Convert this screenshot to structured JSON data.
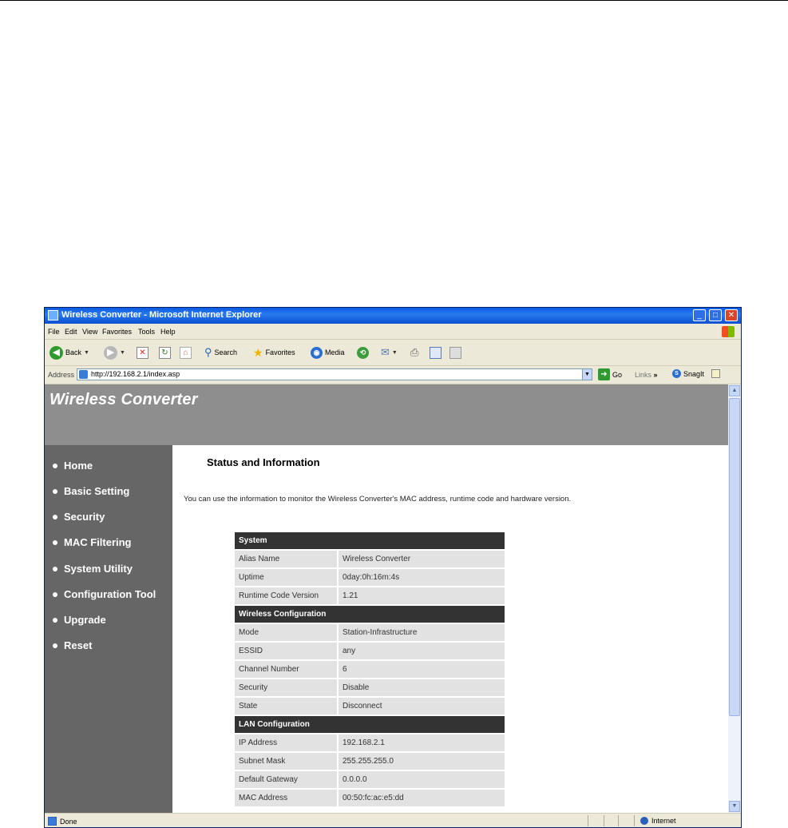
{
  "window": {
    "title": "Wireless Converter - Microsoft Internet Explorer",
    "controls": {
      "minimize": "_",
      "maximize": "□",
      "close": "✕"
    }
  },
  "menu": [
    "File",
    "Edit",
    "View",
    "Favorites",
    "Tools",
    "Help"
  ],
  "toolbar": {
    "back": "Back",
    "search": "Search",
    "favorites": "Favorites",
    "media": "Media"
  },
  "address": {
    "label": "Address",
    "url": "http://192.168.2.1/index.asp",
    "go": "Go",
    "links": "Links",
    "snagit": "SnagIt"
  },
  "page": {
    "banner_title": "Wireless Converter",
    "nav": [
      "Home",
      "Basic Setting",
      "Security",
      "MAC Filtering",
      "System Utility",
      "Configuration Tool",
      "Upgrade",
      "Reset"
    ],
    "title": "Status and Information",
    "intro": "You can use the information to monitor the Wireless Converter's MAC address, runtime code and hardware version.",
    "sections": [
      {
        "header": "System",
        "rows": [
          {
            "key": "Alias Name",
            "value": "Wireless Converter"
          },
          {
            "key": "Uptime",
            "value": "0day:0h:16m:4s"
          },
          {
            "key": "Runtime Code Version",
            "value": "1.21"
          }
        ]
      },
      {
        "header": "Wireless Configuration",
        "rows": [
          {
            "key": "Mode",
            "value": "Station-Infrastructure"
          },
          {
            "key": "ESSID",
            "value": "any"
          },
          {
            "key": "Channel Number",
            "value": "6"
          },
          {
            "key": "Security",
            "value": "Disable"
          },
          {
            "key": "State",
            "value": "Disconnect"
          }
        ]
      },
      {
        "header": "LAN Configuration",
        "rows": [
          {
            "key": "IP Address",
            "value": "192.168.2.1"
          },
          {
            "key": "Subnet Mask",
            "value": "255.255.255.0"
          },
          {
            "key": "Default Gateway",
            "value": "0.0.0.0"
          },
          {
            "key": "MAC Address",
            "value": "00:50:fc:ac:e5:dd"
          }
        ]
      }
    ]
  },
  "status_bar": {
    "left": "Done",
    "zone": "Internet"
  }
}
